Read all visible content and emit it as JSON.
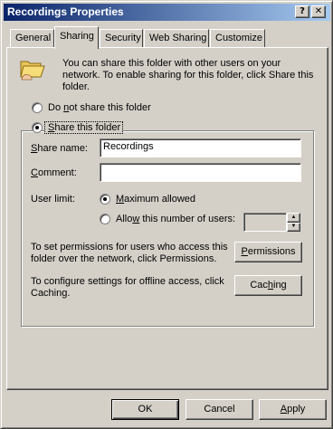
{
  "window": {
    "title": "Recordings Properties",
    "help_button": "?",
    "close_button": "✕"
  },
  "tabs": [
    {
      "label": "General",
      "active": false
    },
    {
      "label": "Sharing",
      "active": true
    },
    {
      "label": "Security",
      "active": false
    },
    {
      "label": "Web Sharing",
      "active": false
    },
    {
      "label": "Customize",
      "active": false
    }
  ],
  "sharing": {
    "info_line1": "You can share this folder with other users on your",
    "info_line2": "network. To enable sharing for this folder, click Share this",
    "info_line3": "folder.",
    "do_not_share_pre": "Do ",
    "do_not_share_access": "n",
    "do_not_share_post": "ot share this folder",
    "share_access": "S",
    "share_post": "hare this folder",
    "share_name_access": "S",
    "share_name_post": "hare name:",
    "share_name_value": "Recordings",
    "comment_access": "C",
    "comment_post": "omment:",
    "comment_value": "",
    "user_limit_label": "User limit:",
    "max_allowed_access": "M",
    "max_allowed_post": "aximum allowed",
    "allow_pre": "Allo",
    "allow_access": "w",
    "allow_post": " this number of users:",
    "users_value": "",
    "permissions_text1": "To set permissions for users who access this",
    "permissions_text2": "folder over the network, click Permissions.",
    "permissions_access": "P",
    "permissions_post": "ermissions",
    "caching_text1": "To configure settings for offline access, click",
    "caching_text2": "Caching.",
    "caching_pre": "Cac",
    "caching_access": "h",
    "caching_post": "ing"
  },
  "buttons": {
    "ok": "OK",
    "cancel": "Cancel",
    "apply_access": "A",
    "apply_post": "pply"
  }
}
